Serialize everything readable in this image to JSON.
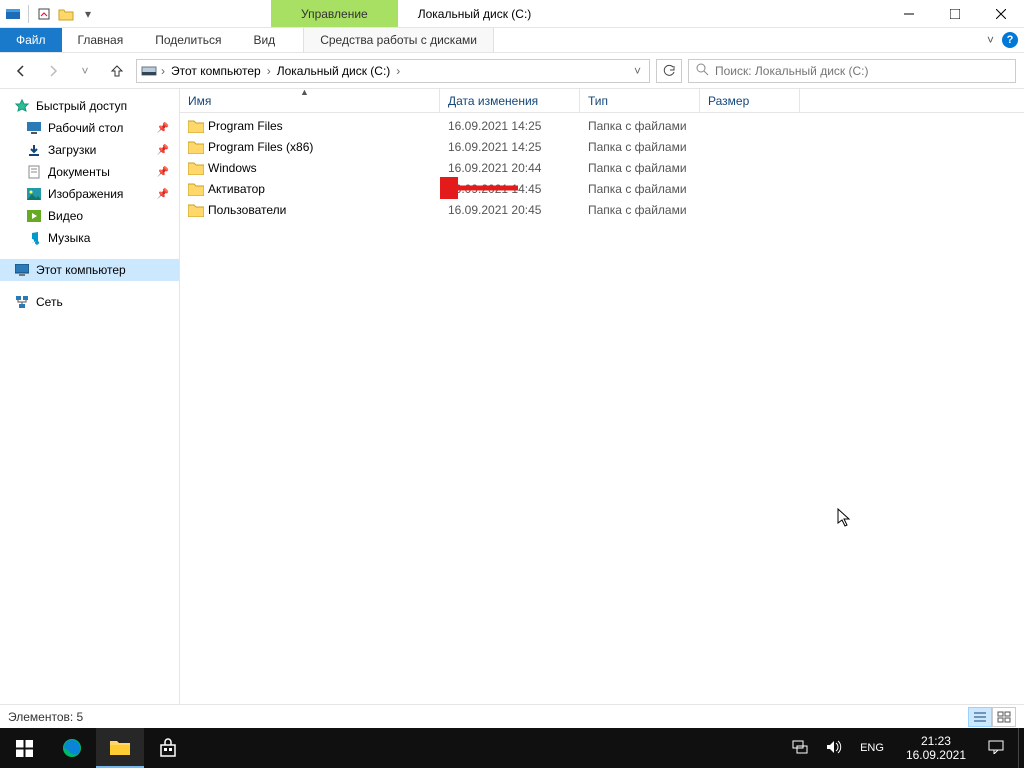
{
  "window": {
    "title": "Локальный диск (C:)",
    "contextual_tab_group": "Управление",
    "ribbon": {
      "file": "Файл",
      "tabs": [
        "Главная",
        "Поделиться",
        "Вид"
      ],
      "contextual": "Средства работы с дисками"
    }
  },
  "nav": {
    "breadcrumbs": [
      "Этот компьютер",
      "Локальный диск (C:)"
    ],
    "search_placeholder": "Поиск: Локальный диск (C:)"
  },
  "sidebar": {
    "quick": {
      "label": "Быстрый доступ",
      "items": [
        {
          "label": "Рабочий стол",
          "icon": "desktop",
          "pinned": true
        },
        {
          "label": "Загрузки",
          "icon": "downloads",
          "pinned": true
        },
        {
          "label": "Документы",
          "icon": "documents",
          "pinned": true
        },
        {
          "label": "Изображения",
          "icon": "pictures",
          "pinned": true
        },
        {
          "label": "Видео",
          "icon": "videos",
          "pinned": false
        },
        {
          "label": "Музыка",
          "icon": "music",
          "pinned": false
        }
      ]
    },
    "this_pc": "Этот компьютер",
    "network": "Сеть"
  },
  "columns": {
    "name": "Имя",
    "date": "Дата изменения",
    "type": "Тип",
    "size": "Размер"
  },
  "rows": [
    {
      "name": "Program Files",
      "date": "16.09.2021 14:25",
      "type": "Папка с файлами",
      "size": ""
    },
    {
      "name": "Program Files (x86)",
      "date": "16.09.2021 14:25",
      "type": "Папка с файлами",
      "size": ""
    },
    {
      "name": "Windows",
      "date": "16.09.2021 20:44",
      "type": "Папка с файлами",
      "size": ""
    },
    {
      "name": "Активатор",
      "date": "16.09.2021 14:45",
      "type": "Папка с файлами",
      "size": ""
    },
    {
      "name": "Пользователи",
      "date": "16.09.2021 20:45",
      "type": "Папка с файлами",
      "size": ""
    }
  ],
  "status": {
    "items_label": "Элементов:",
    "count": "5"
  },
  "tray": {
    "lang": "ENG",
    "time": "21:23",
    "date": "16.09.2021"
  }
}
